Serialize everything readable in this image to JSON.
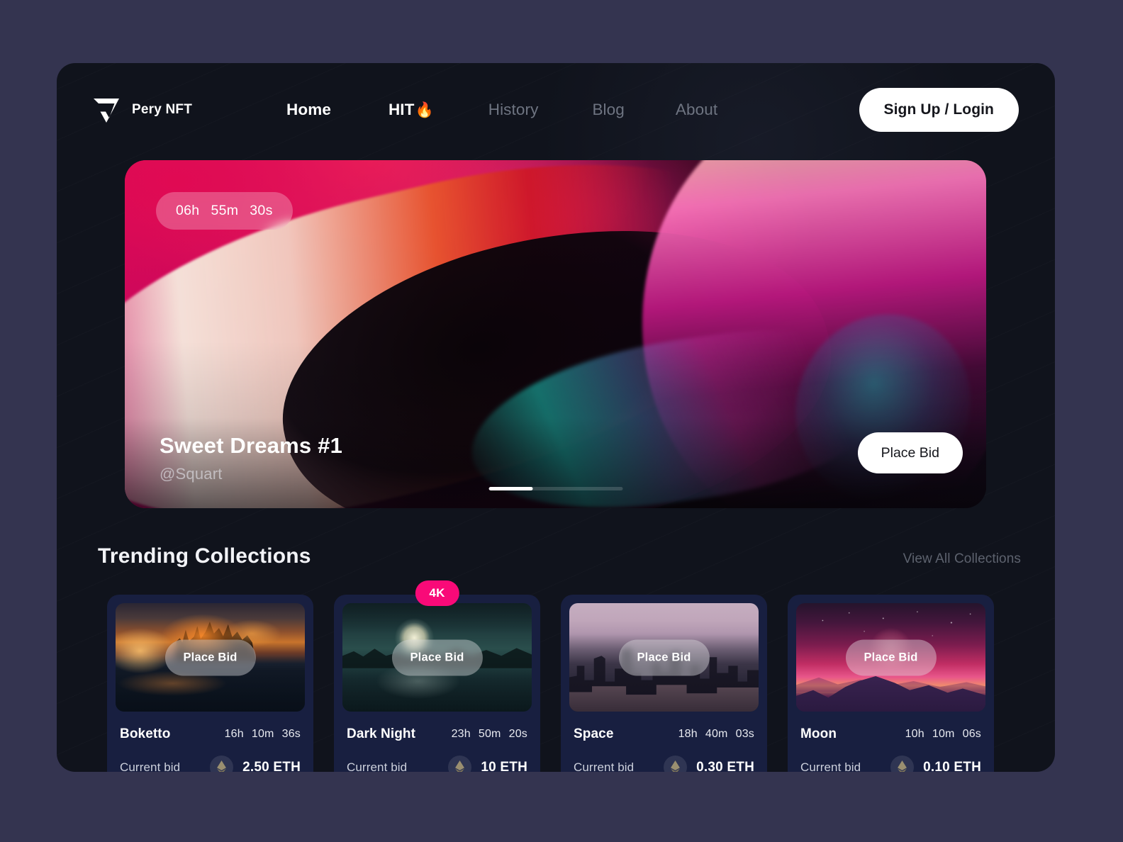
{
  "brand": {
    "name": "Pery NFT",
    "logo_icon": "pery-triangle-logo-icon"
  },
  "nav": {
    "items": [
      {
        "label": "Home",
        "state": "active"
      },
      {
        "label": "HIT",
        "state": "hot",
        "emoji": "🔥"
      },
      {
        "label": "History",
        "state": "default"
      },
      {
        "label": "Blog",
        "state": "default"
      },
      {
        "label": "About",
        "state": "default"
      }
    ],
    "auth_button": "Sign Up / Login"
  },
  "hero": {
    "timer": {
      "hours": "06h",
      "minutes": "55m",
      "seconds": "30s"
    },
    "title": "Sweet Dreams #1",
    "author": "@Squart",
    "bid_button": "Place Bid",
    "carousel": {
      "slide": 1,
      "total": 3,
      "fill_percent": 33
    }
  },
  "trending": {
    "title": "Trending Collections",
    "view_all": "View All Collections",
    "cards": [
      {
        "name": "Boketto",
        "art": "burning-castle-sunset",
        "bid_button": "Place Bid",
        "timer": {
          "hours": "16h",
          "minutes": "10m",
          "seconds": "36s"
        },
        "bid_label": "Current bid",
        "price": "2.50 ETH",
        "badge": null
      },
      {
        "name": "Dark Night",
        "art": "moonlit-lake",
        "bid_button": "Place Bid",
        "timer": {
          "hours": "23h",
          "minutes": "50m",
          "seconds": "20s"
        },
        "bid_label": "Current bid",
        "price": "10 ETH",
        "badge": "4K"
      },
      {
        "name": "Space",
        "art": "city-skyline-dusk",
        "bid_button": "Place Bid",
        "timer": {
          "hours": "18h",
          "minutes": "40m",
          "seconds": "03s"
        },
        "bid_label": "Current bid",
        "price": "0.30 ETH",
        "badge": null
      },
      {
        "name": "Moon",
        "art": "pink-mountain-night",
        "bid_button": "Place Bid",
        "timer": {
          "hours": "10h",
          "minutes": "10m",
          "seconds": "06s"
        },
        "bid_label": "Current bid",
        "price": "0.10 ETH",
        "badge": null
      }
    ]
  },
  "colors": {
    "page_background": "#343450",
    "window_background": "#10131c",
    "card_background": "#181f40",
    "accent_pink": "#f90a78",
    "text_primary": "#ffffff",
    "text_muted": "#6e7481",
    "button_light": "#ffffff"
  }
}
